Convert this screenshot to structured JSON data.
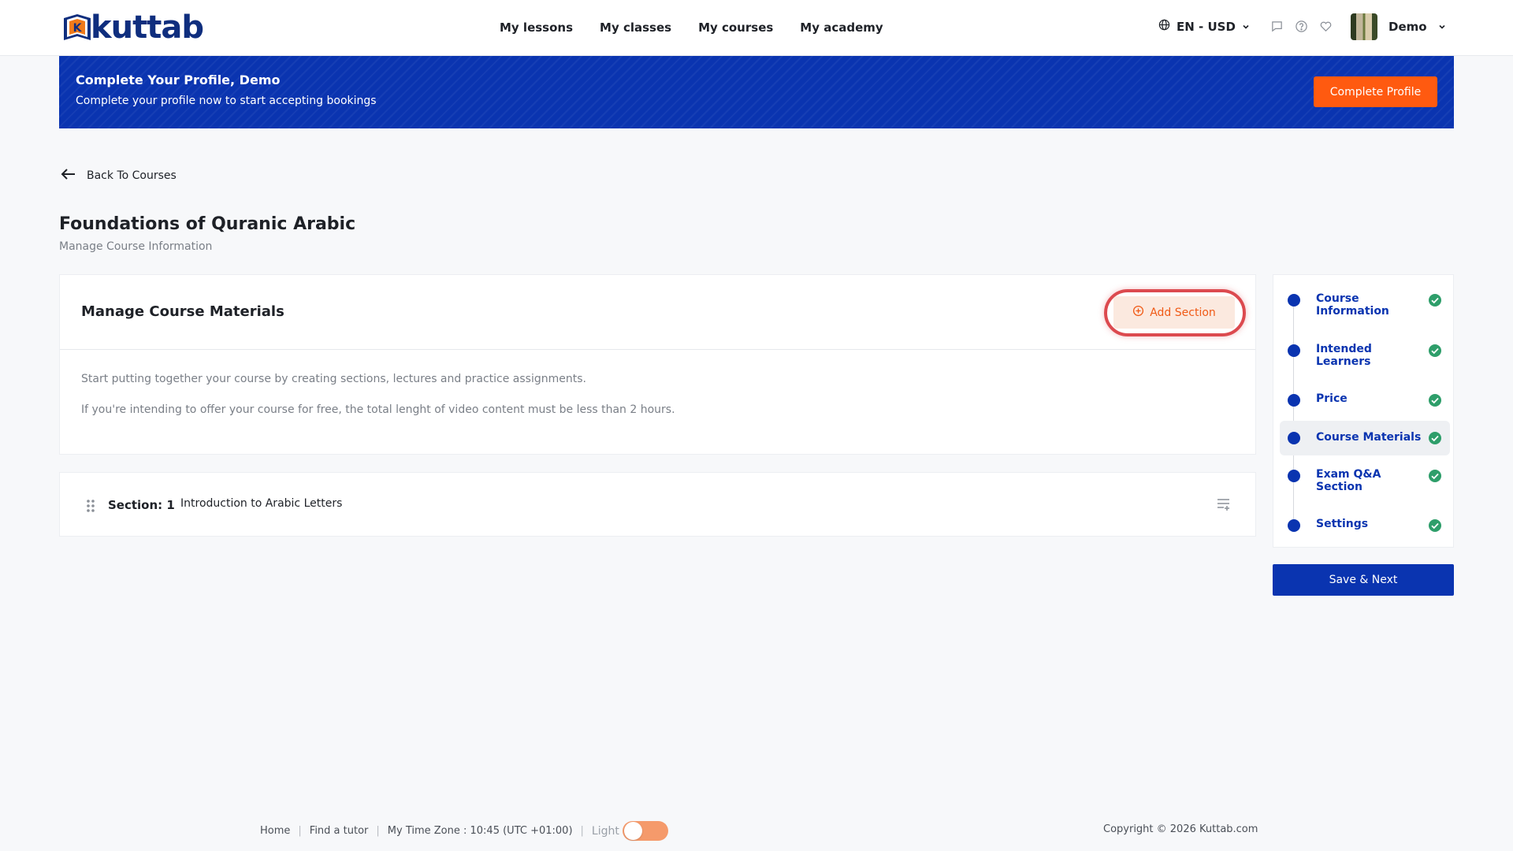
{
  "brand": {
    "name": "kuttab",
    "mark_letter": "K"
  },
  "nav": {
    "items": [
      "My lessons",
      "My classes",
      "My courses",
      "My academy"
    ]
  },
  "header": {
    "locale": "EN - USD",
    "icons": [
      "chat-icon",
      "help-icon",
      "heart-icon"
    ],
    "user_name": "Demo"
  },
  "banner": {
    "title": "Complete Your Profile, Demo",
    "subtitle": "Complete your profile now to start accepting bookings",
    "button": "Complete Profile"
  },
  "back_link": "Back To Courses",
  "course": {
    "title": "Foundations of Quranic Arabic",
    "subtitle": "Manage Course Information"
  },
  "materials": {
    "title": "Manage Course Materials",
    "add_button": "Add Section",
    "intro": "Start putting together your course by creating sections, lectures and practice assignments.",
    "note": "If you're intending to offer your course for free, the total lenght of video content must be less than 2 hours."
  },
  "sections": [
    {
      "label": "Section: 1",
      "name": "Introduction to Arabic Letters"
    }
  ],
  "steps": [
    {
      "label": "Course Information",
      "completed": true,
      "active": false
    },
    {
      "label": "Intended Learners",
      "completed": true,
      "active": false
    },
    {
      "label": "Price",
      "completed": true,
      "active": false
    },
    {
      "label": "Course Materials",
      "completed": true,
      "active": true
    },
    {
      "label": "Exam Q&A Section",
      "completed": true,
      "active": false
    },
    {
      "label": "Settings",
      "completed": true,
      "active": false
    }
  ],
  "save_button": "Save & Next",
  "footer": {
    "links": [
      "Home",
      "Find a tutor"
    ],
    "timezone": "My Time Zone : 10:45 (UTC +01:00)",
    "theme_label": "Light",
    "copyright": "Copyright © 2026 Kuttab.com"
  },
  "colors": {
    "primary": "#0a34b0",
    "accent": "#ff5a10",
    "success": "#2e9e6a",
    "highlight_ring": "#dc4a4f"
  }
}
